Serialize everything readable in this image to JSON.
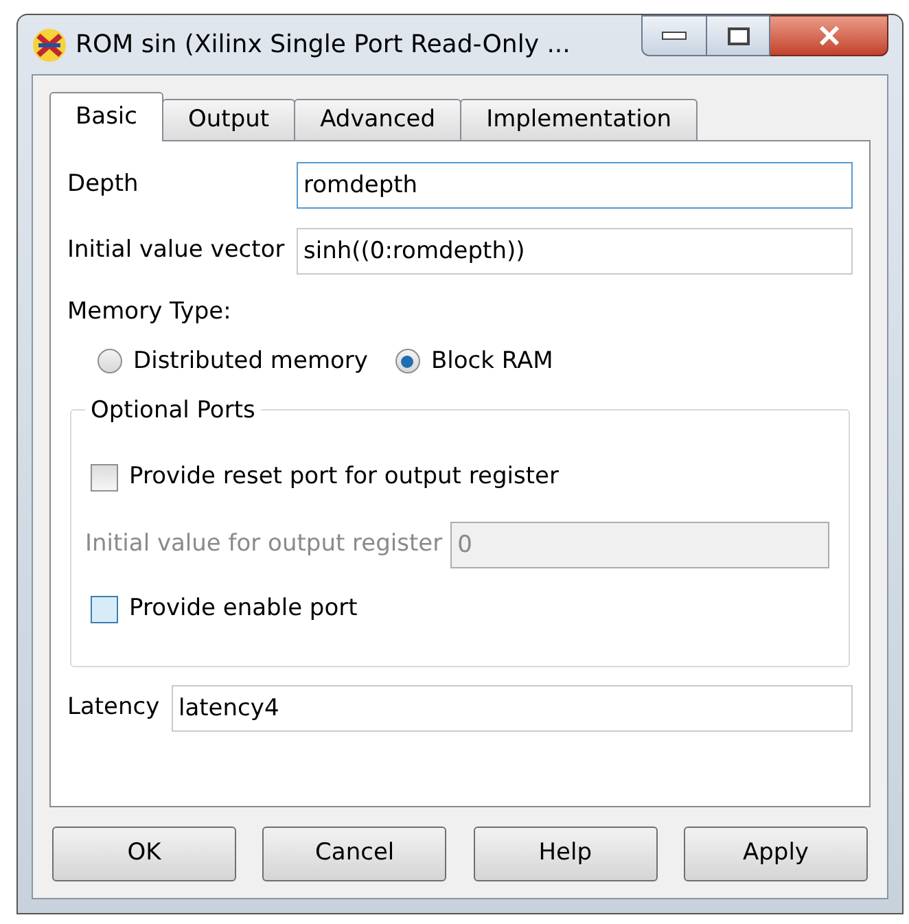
{
  "window": {
    "title": "ROM sin (Xilinx Single Port Read-Only ..."
  },
  "tabs": [
    {
      "label": "Basic",
      "selected": true
    },
    {
      "label": "Output",
      "selected": false
    },
    {
      "label": "Advanced",
      "selected": false
    },
    {
      "label": "Implementation",
      "selected": false
    }
  ],
  "depth": {
    "label": "Depth",
    "value": "romdepth",
    "focused": true
  },
  "initial_value_vector": {
    "label": "Initial value vector",
    "value": "sinh((0:romdepth))"
  },
  "memory_type": {
    "label": "Memory Type:",
    "options": [
      {
        "label": "Distributed memory",
        "selected": false
      },
      {
        "label": "Block RAM",
        "selected": true
      }
    ]
  },
  "optional_ports": {
    "title": "Optional Ports",
    "reset_port": {
      "label": "Provide reset port for output register",
      "checked": false,
      "hovered": false
    },
    "initial_output": {
      "label": "Initial value for output register",
      "value": "0",
      "disabled": true
    },
    "enable_port": {
      "label": "Provide enable port",
      "checked": false,
      "hovered": true
    }
  },
  "latency": {
    "label": "Latency",
    "value": "latency4"
  },
  "buttons": [
    "OK",
    "Cancel",
    "Help",
    "Apply"
  ]
}
